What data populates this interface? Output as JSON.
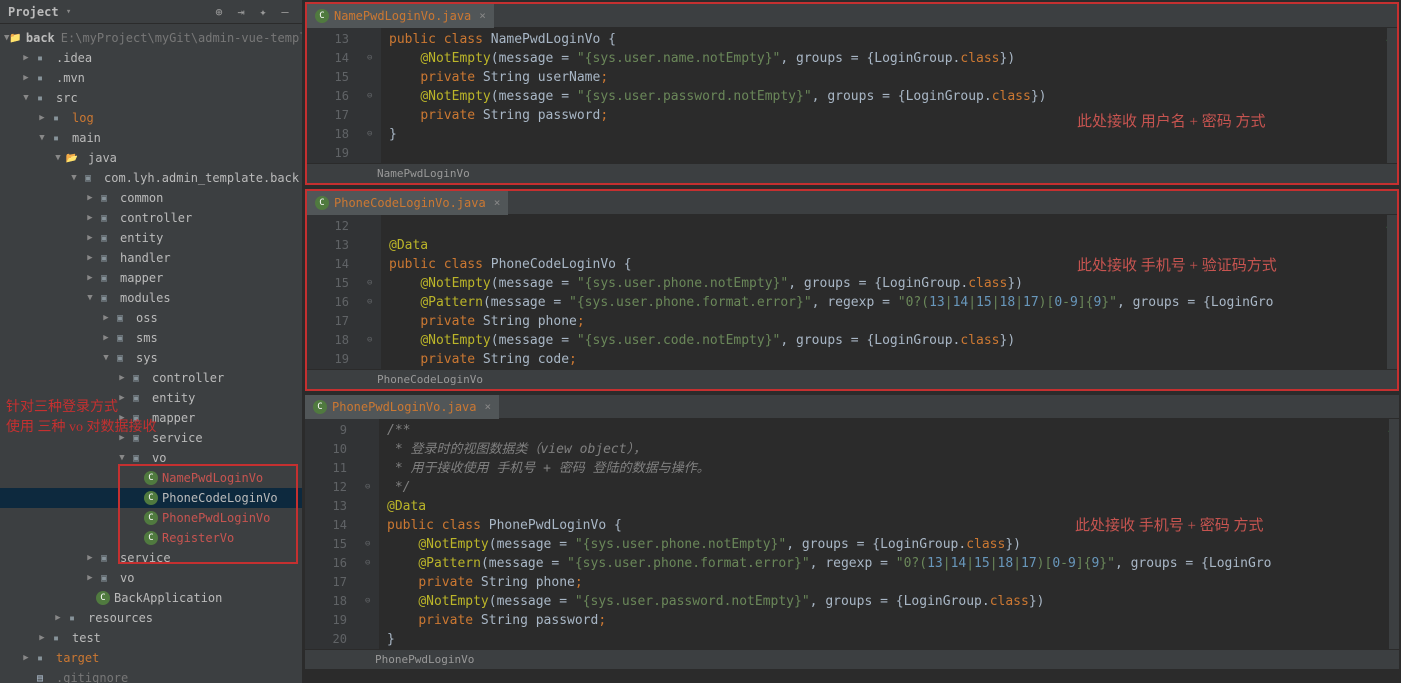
{
  "sidebar": {
    "title": "Project",
    "rootName": "back",
    "rootPath": "E:\\myProject\\myGit\\admin-vue-template",
    "nodes": [
      {
        "indent": 1,
        "arrow": "closed",
        "icon": "folder",
        "label": ".idea"
      },
      {
        "indent": 1,
        "arrow": "closed",
        "icon": "folder",
        "label": ".mvn"
      },
      {
        "indent": 1,
        "arrow": "open",
        "icon": "folder",
        "label": "src"
      },
      {
        "indent": 2,
        "arrow": "closed",
        "icon": "folder",
        "label": "log",
        "orange": true
      },
      {
        "indent": 2,
        "arrow": "open",
        "icon": "folder",
        "label": "main"
      },
      {
        "indent": 3,
        "arrow": "open",
        "icon": "folder-open",
        "label": "java"
      },
      {
        "indent": 4,
        "arrow": "open",
        "icon": "pkg",
        "label": "com.lyh.admin_template.back"
      },
      {
        "indent": 5,
        "arrow": "closed",
        "icon": "pkg",
        "label": "common"
      },
      {
        "indent": 5,
        "arrow": "closed",
        "icon": "pkg",
        "label": "controller"
      },
      {
        "indent": 5,
        "arrow": "closed",
        "icon": "pkg",
        "label": "entity"
      },
      {
        "indent": 5,
        "arrow": "closed",
        "icon": "pkg",
        "label": "handler"
      },
      {
        "indent": 5,
        "arrow": "closed",
        "icon": "pkg",
        "label": "mapper"
      },
      {
        "indent": 5,
        "arrow": "open",
        "icon": "pkg",
        "label": "modules"
      },
      {
        "indent": 6,
        "arrow": "closed",
        "icon": "pkg",
        "label": "oss"
      },
      {
        "indent": 6,
        "arrow": "closed",
        "icon": "pkg",
        "label": "sms"
      },
      {
        "indent": 6,
        "arrow": "open",
        "icon": "pkg",
        "label": "sys"
      },
      {
        "indent": 7,
        "arrow": "closed",
        "icon": "pkg",
        "label": "controller"
      },
      {
        "indent": 7,
        "arrow": "closed",
        "icon": "pkg",
        "label": "entity"
      },
      {
        "indent": 7,
        "arrow": "closed",
        "icon": "pkg",
        "label": "mapper"
      },
      {
        "indent": 7,
        "arrow": "closed",
        "icon": "pkg",
        "label": "service"
      },
      {
        "indent": 7,
        "arrow": "open",
        "icon": "pkg",
        "label": "vo"
      },
      {
        "indent": 8,
        "arrow": "none",
        "icon": "java",
        "label": "NamePwdLoginVo",
        "red": true
      },
      {
        "indent": 8,
        "arrow": "none",
        "icon": "java",
        "label": "PhoneCodeLoginVo",
        "selected": true
      },
      {
        "indent": 8,
        "arrow": "none",
        "icon": "java",
        "label": "PhonePwdLoginVo",
        "red": true
      },
      {
        "indent": 8,
        "arrow": "none",
        "icon": "java",
        "label": "RegisterVo",
        "red": true
      },
      {
        "indent": 5,
        "arrow": "closed",
        "icon": "pkg",
        "label": "service"
      },
      {
        "indent": 5,
        "arrow": "closed",
        "icon": "pkg",
        "label": "vo"
      },
      {
        "indent": 5,
        "arrow": "none",
        "icon": "java",
        "label": "BackApplication"
      },
      {
        "indent": 3,
        "arrow": "closed",
        "icon": "folder",
        "label": "resources"
      },
      {
        "indent": 2,
        "arrow": "closed",
        "icon": "folder",
        "label": "test"
      },
      {
        "indent": 1,
        "arrow": "closed",
        "icon": "folder",
        "label": "target",
        "orange": true
      },
      {
        "indent": 1,
        "arrow": "none",
        "icon": "file",
        "label": ".gitignore",
        "dim": true
      }
    ],
    "annotLine1": "针对三种登录方式",
    "annotLine2": "使用 三种 vo 对数据接收"
  },
  "editors": [
    {
      "tab": "NamePwdLoginVo.java",
      "breadcrumb": "NamePwdLoginVo",
      "annot": "此处接收 用户名  + 密码 方式",
      "annotTop": 82,
      "annotLeft": 770,
      "startLine": 13,
      "lines": [
        {
          "n": 13,
          "html": "<span class='kw'>public class </span>NamePwdLoginVo {"
        },
        {
          "n": 14,
          "fold": "⊖",
          "html": "    <span class='ann'>@NotEmpty</span>(message = <span class='str'>\"{sys.user.name.notEmpty}\"</span>, groups = {LoginGroup.<span class='kw'>class</span>})"
        },
        {
          "n": 15,
          "html": "    <span class='kw'>private</span> String userName<span class='kw'>;</span>"
        },
        {
          "n": 16,
          "fold": "⊖",
          "html": "    <span class='ann'>@NotEmpty</span>(message = <span class='str'>\"{sys.user.password.notEmpty}\"</span>, groups = {LoginGroup.<span class='kw'>class</span>})"
        },
        {
          "n": 17,
          "html": "    <span class='kw'>private</span> String password<span class='kw'>;</span>"
        },
        {
          "n": 18,
          "fold": "⊖",
          "html": "}"
        },
        {
          "n": 19,
          "html": ""
        }
      ]
    },
    {
      "tab": "PhoneCodeLoginVo.java",
      "breadcrumb": "PhoneCodeLoginVo",
      "annot": "此处接收 手机号 + 验证码方式",
      "annotTop": 39,
      "annotLeft": 770,
      "startLine": 12,
      "lines": [
        {
          "n": 12,
          "html": ""
        },
        {
          "n": 13,
          "html": "<span class='ann'>@Data</span>"
        },
        {
          "n": 14,
          "html": "<span class='kw'>public class </span>PhoneCodeLoginVo {"
        },
        {
          "n": 15,
          "fold": "⊖",
          "html": "    <span class='ann'>@NotEmpty</span>(message = <span class='str'>\"{sys.user.phone.notEmpty}\"</span>, groups = {LoginGroup.<span class='kw'>class</span>})"
        },
        {
          "n": 16,
          "fold": "⊖",
          "html": "    <span class='ann'>@Pattern</span>(message = <span class='str'>\"{sys.user.phone.format.error}\"</span>, regexp = <span class='str'>\"0?(</span><span class='num'>13</span><span class='str'>|</span><span class='num'>14</span><span class='str'>|</span><span class='num'>15</span><span class='str'>|</span><span class='num'>18</span><span class='str'>|</span><span class='num'>17</span><span class='str'>)[</span><span class='num'>0</span><span class='str'>-</span><span class='num'>9</span><span class='str'>]{</span><span class='num'>9</span><span class='str'>}\"</span>, groups = {LoginGro"
        },
        {
          "n": 17,
          "html": "    <span class='kw'>private</span> String phone<span class='kw'>;</span>"
        },
        {
          "n": 18,
          "fold": "⊖",
          "html": "    <span class='ann'>@NotEmpty</span>(message = <span class='str'>\"{sys.user.code.notEmpty}\"</span>, groups = {LoginGroup.<span class='kw'>class</span>})"
        },
        {
          "n": 19,
          "html": "    <span class='kw'>private</span> String code<span class='kw'>;</span>"
        }
      ]
    },
    {
      "tab": "PhonePwdLoginVo.java",
      "breadcrumb": "PhonePwdLoginVo",
      "annot": "此处接收 手机号 + 密码 方式",
      "annotTop": 95,
      "annotLeft": 770,
      "startLine": 9,
      "noborder": true,
      "innerBoxTop": 117,
      "lines": [
        {
          "n": 9,
          "html": "<span class='com'>/**</span>"
        },
        {
          "n": 10,
          "html": "<span class='com'> * 登录时的视图数据类（view object），</span>"
        },
        {
          "n": 11,
          "html": "<span class='com'> * 用于接收使用 手机号 + 密码 登陆的数据与操作。</span>"
        },
        {
          "n": 12,
          "fold": "⊖",
          "html": "<span class='com'> */</span>"
        },
        {
          "n": 13,
          "html": "<span class='ann'>@Data</span>"
        },
        {
          "n": 14,
          "html": "<span class='kw'>public class </span>PhonePwdLoginVo {"
        },
        {
          "n": 15,
          "fold": "⊖",
          "html": "    <span class='ann'>@NotEmpty</span>(message = <span class='str'>\"{sys.user.phone.notEmpty}\"</span>, groups = {LoginGroup.<span class='kw'>class</span>})"
        },
        {
          "n": 16,
          "fold": "⊖",
          "html": "    <span class='ann'>@Pattern</span>(message = <span class='str'>\"{sys.user.phone.format.error}\"</span>, regexp = <span class='str'>\"0?(</span><span class='num'>13</span><span class='str'>|</span><span class='num'>14</span><span class='str'>|</span><span class='num'>15</span><span class='str'>|</span><span class='num'>18</span><span class='str'>|</span><span class='num'>17</span><span class='str'>)[</span><span class='num'>0</span><span class='str'>-</span><span class='num'>9</span><span class='str'>]{</span><span class='num'>9</span><span class='str'>}\"</span>, groups = {LoginGro"
        },
        {
          "n": 17,
          "html": "    <span class='kw'>private</span> String phone<span class='kw'>;</span>"
        },
        {
          "n": 18,
          "fold": "⊖",
          "html": "    <span class='ann'>@NotEmpty</span>(message = <span class='str'>\"{sys.user.password.notEmpty}\"</span>, groups = {LoginGroup.<span class='kw'>class</span>})"
        },
        {
          "n": 19,
          "html": "    <span class='kw'>private</span> String password<span class='kw'>;</span>"
        },
        {
          "n": 20,
          "html": "}"
        }
      ]
    }
  ]
}
